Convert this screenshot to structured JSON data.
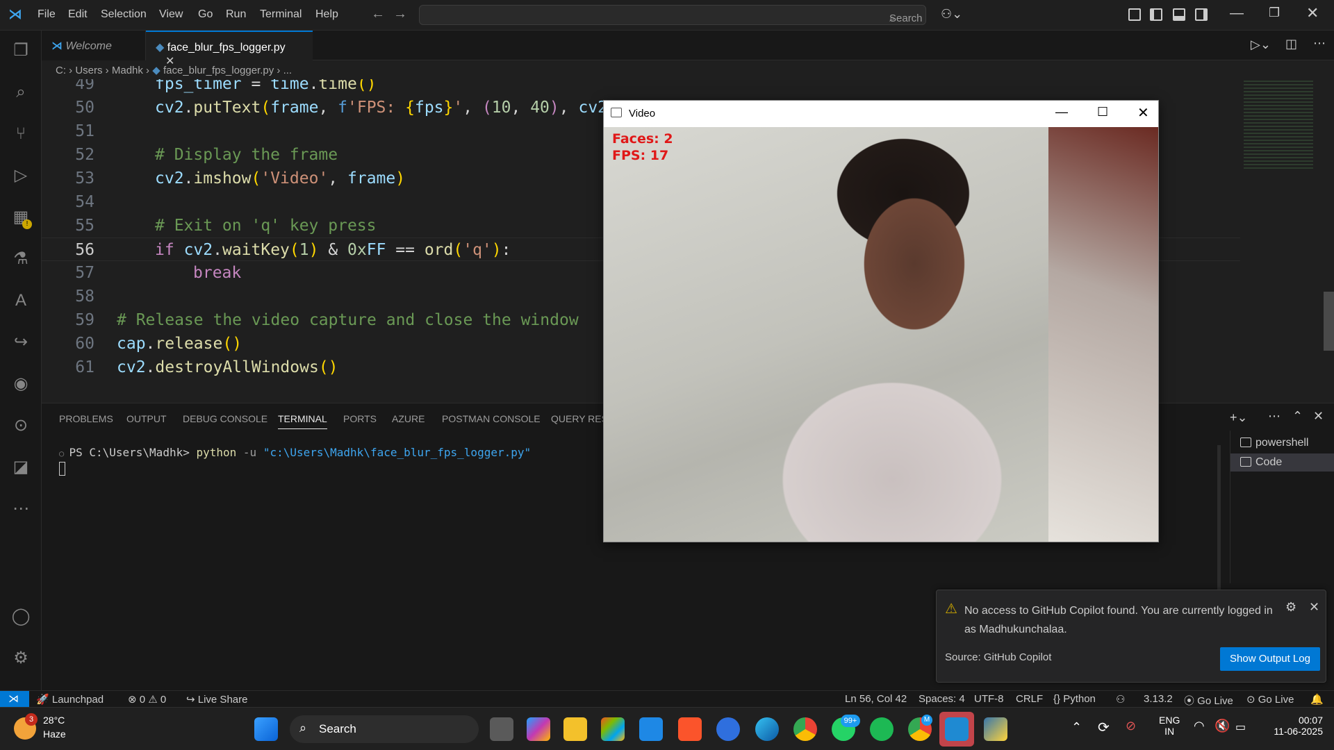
{
  "titlebar": {
    "menu": [
      "File",
      "Edit",
      "Selection",
      "View",
      "Go",
      "Run",
      "Terminal",
      "Help"
    ],
    "search_placeholder": "Search"
  },
  "tabs": [
    {
      "label": "Welcome"
    },
    {
      "label": "face_blur_fps_logger.py"
    }
  ],
  "breadcrumb": {
    "c": "C:",
    "users": "Users",
    "user": "Madhk",
    "file": "face_blur_fps_logger.py",
    "more": "..."
  },
  "editor": {
    "line_numbers": [
      "49",
      "50",
      "51",
      "52",
      "53",
      "54",
      "55",
      "56",
      "57",
      "58",
      "59",
      "60",
      "61"
    ],
    "current_line": "56"
  },
  "panel": {
    "tabs": [
      "PROBLEMS",
      "OUTPUT",
      "DEBUG CONSOLE",
      "TERMINAL",
      "PORTS",
      "AZURE",
      "POSTMAN CONSOLE",
      "QUERY RESU"
    ],
    "active_tab": "TERMINAL",
    "terminal_prompt": "PS C:\\Users\\Madhk> ",
    "terminal_cmd": "python",
    "terminal_flag": " -u ",
    "terminal_arg": "\"c:\\Users\\Madhk\\face_blur_fps_logger.py\"",
    "terminals": [
      "powershell",
      "Code"
    ]
  },
  "notification": {
    "message": "No access to GitHub Copilot found. You are currently logged in as Madhukunchalaa.",
    "source": "Source: GitHub Copilot",
    "button": "Show Output Log"
  },
  "video_window": {
    "title": "Video",
    "overlay_faces": "Faces: 2",
    "overlay_fps": "FPS: 17"
  },
  "statusbar": {
    "launchpad": "Launchpad",
    "errors": "0",
    "warnings": "0",
    "live_share": "Live Share",
    "cursor": "Ln 56, Col 42",
    "spaces": "Spaces: 4",
    "encoding": "UTF-8",
    "eol": "CRLF",
    "language": "Python",
    "py_version": "3.13.2",
    "golive1": "Go Live",
    "golive2": "Go Live"
  },
  "taskbar": {
    "weather_temp": "28°C",
    "weather_desc": "Haze",
    "weather_badge": "3",
    "search": "Search",
    "whatsapp_badge": "99+",
    "chrome_badge": "M",
    "lang1": "ENG",
    "lang2": "IN",
    "time": "00:07",
    "date": "11-06-2025"
  },
  "colors": {
    "accent": "#0078d4",
    "overlay_red": "#e01818"
  }
}
